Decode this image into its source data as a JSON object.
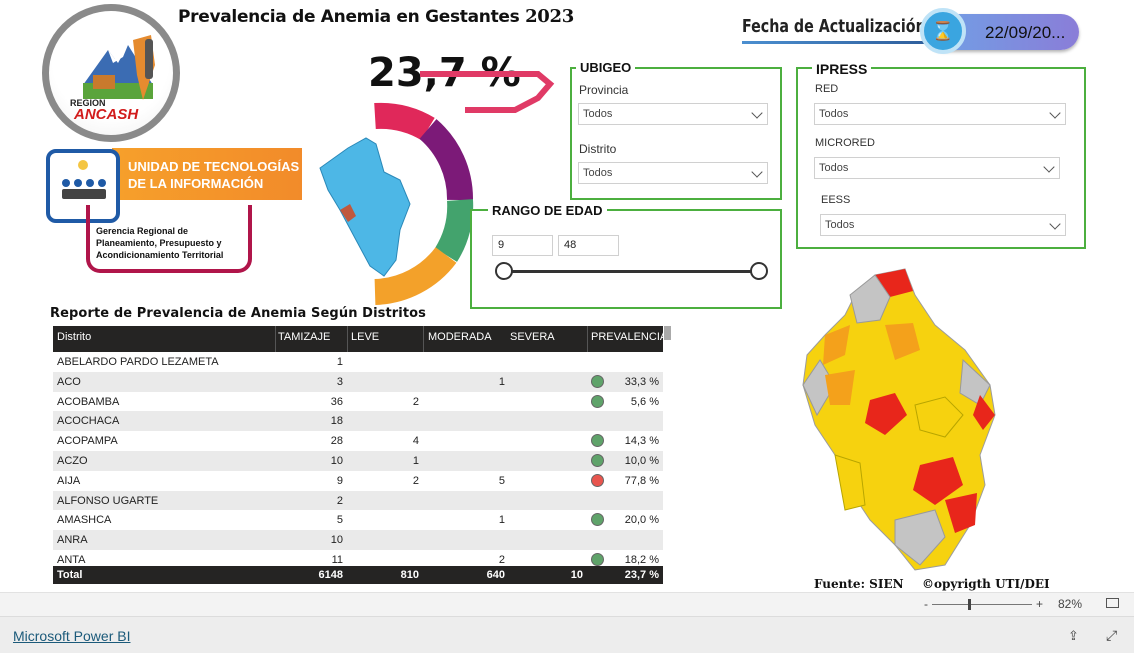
{
  "report": {
    "title": "Prevalencia de Anemia en Gestantes",
    "title_year": "2023",
    "kpi_value": "23,7 %",
    "fecha_label": "Fecha de Actualización",
    "fecha_value": "22/09/20...",
    "logo_region": "REGION",
    "logo_name": "ANCASH",
    "uti_line1": "UNIDAD DE TECNOLOGÍAS",
    "uti_line2": "DE LA INFORMACIÓN",
    "gerencia_line1": "Gerencia Regional de",
    "gerencia_line2": "Planeamiento, Presupuesto y",
    "gerencia_line3": "Acondicionamiento Territorial",
    "fuente": "Fuente: SIEN",
    "copyright": "©opyrigth UTI/DEI"
  },
  "ubigeo": {
    "title": "UBIGEO",
    "provincia_label": "Provincia",
    "provincia_value": "Todos",
    "distrito_label": "Distrito",
    "distrito_value": "Todos"
  },
  "ipress": {
    "title": "IPRESS",
    "red_label": "RED",
    "red_value": "Todos",
    "microred_label": "MICRORED",
    "microred_value": "Todos",
    "eess_label": "EESS",
    "eess_value": "Todos"
  },
  "edad": {
    "title": "RANGO DE EDAD",
    "min": "9",
    "max": "48"
  },
  "table": {
    "title": "Reporte de Prevalencia de Anemia Según Distritos",
    "headers": [
      "Distrito",
      "TAMIZAJE",
      "LEVE",
      "MODERADA",
      "SEVERA",
      "PREVALENCIA"
    ],
    "rows": [
      {
        "distrito": "ABELARDO PARDO LEZAMETA",
        "tamizaje": "1",
        "leve": "",
        "moderada": "",
        "severa": "",
        "prev": "",
        "status": ""
      },
      {
        "distrito": "ACO",
        "tamizaje": "3",
        "leve": "",
        "moderada": "1",
        "severa": "",
        "prev": "33,3 %",
        "status": "green"
      },
      {
        "distrito": "ACOBAMBA",
        "tamizaje": "36",
        "leve": "2",
        "moderada": "",
        "severa": "",
        "prev": "5,6 %",
        "status": "green"
      },
      {
        "distrito": "ACOCHACA",
        "tamizaje": "18",
        "leve": "",
        "moderada": "",
        "severa": "",
        "prev": "",
        "status": ""
      },
      {
        "distrito": "ACOPAMPA",
        "tamizaje": "28",
        "leve": "4",
        "moderada": "",
        "severa": "",
        "prev": "14,3 %",
        "status": "green"
      },
      {
        "distrito": "ACZO",
        "tamizaje": "10",
        "leve": "1",
        "moderada": "",
        "severa": "",
        "prev": "10,0 %",
        "status": "green"
      },
      {
        "distrito": "AIJA",
        "tamizaje": "9",
        "leve": "2",
        "moderada": "5",
        "severa": "",
        "prev": "77,8 %",
        "status": "red"
      },
      {
        "distrito": "ALFONSO UGARTE",
        "tamizaje": "2",
        "leve": "",
        "moderada": "",
        "severa": "",
        "prev": "",
        "status": ""
      },
      {
        "distrito": "AMASHCA",
        "tamizaje": "5",
        "leve": "",
        "moderada": "1",
        "severa": "",
        "prev": "20,0 %",
        "status": "green"
      },
      {
        "distrito": "ANRA",
        "tamizaje": "10",
        "leve": "",
        "moderada": "",
        "severa": "",
        "prev": "",
        "status": ""
      },
      {
        "distrito": "ANTA",
        "tamizaje": "11",
        "leve": "",
        "moderada": "2",
        "severa": "",
        "prev": "18,2 %",
        "status": "green"
      }
    ],
    "total": {
      "label": "Total",
      "tamizaje": "6148",
      "leve": "810",
      "moderada": "640",
      "severa": "10",
      "prev": "23,7 %"
    }
  },
  "colors": {
    "status_green": "#5fa36a",
    "status_red": "#e8554e",
    "panel_border": "#4caf3f"
  },
  "statusbar": {
    "zoom_minus": "-",
    "zoom_plus": "+",
    "zoom": "82%"
  },
  "footer": {
    "link": "Microsoft Power BI"
  }
}
